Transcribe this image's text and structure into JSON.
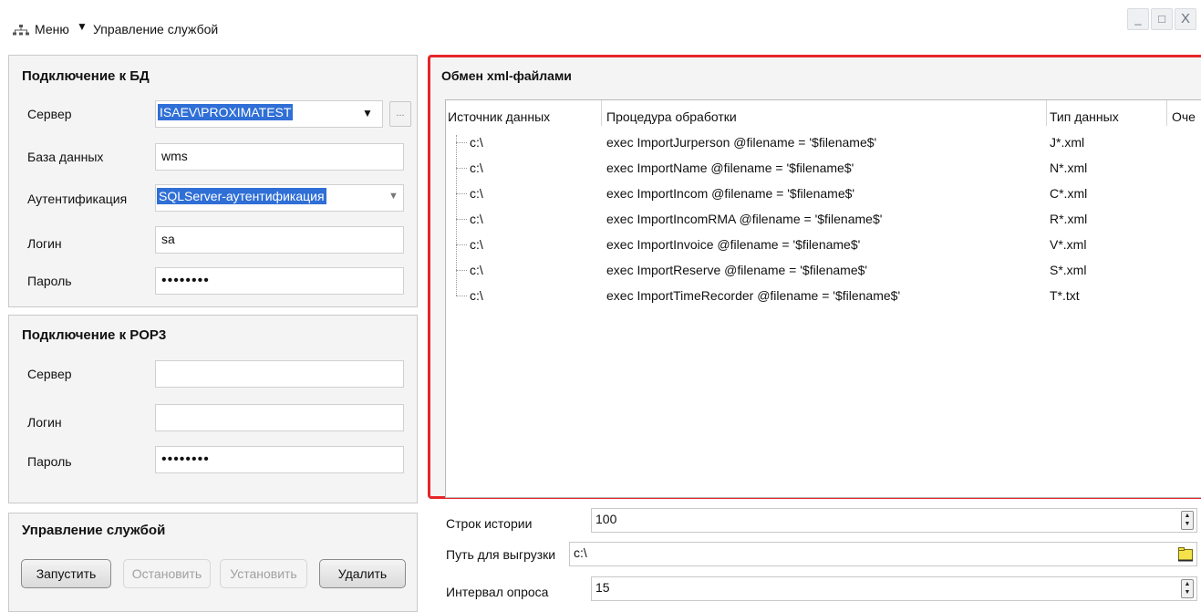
{
  "window": {
    "menu_label": "Меню",
    "menu_arrow": "▼",
    "title": "Управление службой",
    "controls": {
      "minimize": "_",
      "maximize": "□",
      "close": "X"
    }
  },
  "db_panel": {
    "title": "Подключение к БД",
    "server_label": "Сервер",
    "server_value": "ISAEV\\PROXIMATEST",
    "server_browse": "...",
    "database_label": "База данных",
    "database_value": "wms",
    "auth_label": "Аутентификация",
    "auth_value": "SQLServer-аутентификация",
    "login_label": "Логин",
    "login_value": "sa",
    "password_label": "Пароль",
    "password_value": "••••••••"
  },
  "pop3_panel": {
    "title": "Подключение к POP3",
    "server_label": "Сервер",
    "server_value": "",
    "login_label": "Логин",
    "login_value": "",
    "password_label": "Пароль",
    "password_value": "••••••••"
  },
  "service_panel": {
    "title": "Управление службой",
    "start": "Запустить",
    "stop": "Остановить",
    "install": "Установить",
    "remove": "Удалить"
  },
  "xml_panel": {
    "title": "Обмен xml-файлами",
    "columns": [
      "Источник данных",
      "Процедура обработки",
      "Тип данных",
      "Оче"
    ],
    "rows": [
      {
        "source": "c:\\",
        "procedure": "exec ImportJurperson @filename = '$filename$'",
        "type": "J*.xml"
      },
      {
        "source": "c:\\",
        "procedure": "exec ImportName @filename = '$filename$'",
        "type": "N*.xml"
      },
      {
        "source": "c:\\",
        "procedure": "exec ImportIncom @filename = '$filename$'",
        "type": "C*.xml"
      },
      {
        "source": "c:\\",
        "procedure": "exec ImportIncomRMA @filename = '$filename$'",
        "type": "R*.xml"
      },
      {
        "source": "c:\\",
        "procedure": "exec ImportInvoice @filename = '$filename$'",
        "type": "V*.xml"
      },
      {
        "source": "c:\\",
        "procedure": "exec ImportReserve @filename = '$filename$'",
        "type": "S*.xml"
      },
      {
        "source": "c:\\",
        "procedure": "exec ImportTimeRecorder @filename = '$filename$'",
        "type": "T*.txt"
      }
    ]
  },
  "settings": {
    "history_label": "Строк истории",
    "history_value": "100",
    "export_path_label": "Путь для выгрузки",
    "export_path_value": "c:\\",
    "interval_label": "Интервал опроса",
    "interval_value": "15"
  },
  "colors": {
    "highlight_border": "#e6262a",
    "selection": "#2f6fd6",
    "panel_bg": "#f4f4f4"
  }
}
